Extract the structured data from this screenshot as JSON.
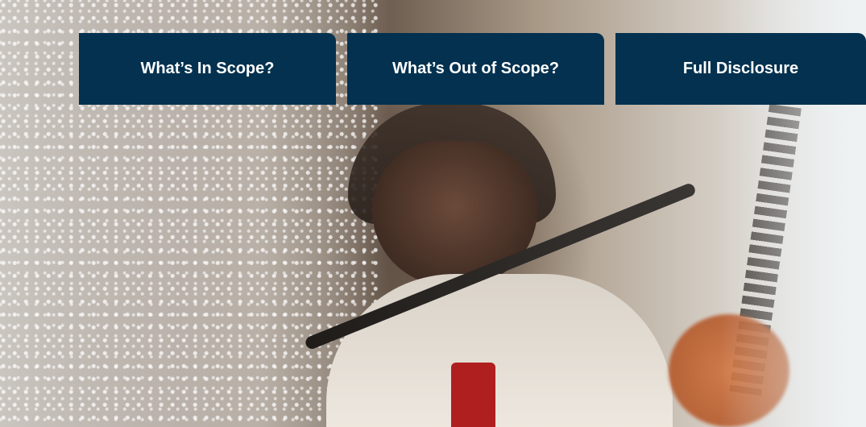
{
  "tabs": [
    {
      "label": "What’s In Scope?"
    },
    {
      "label": "What’s Out of Scope?"
    },
    {
      "label": "Full Disclosure"
    }
  ],
  "colors": {
    "tab_background": "#03314f",
    "tab_text": "#ffffff"
  },
  "hero_image": {
    "icon": "photo-worker-plastic-flakes"
  }
}
